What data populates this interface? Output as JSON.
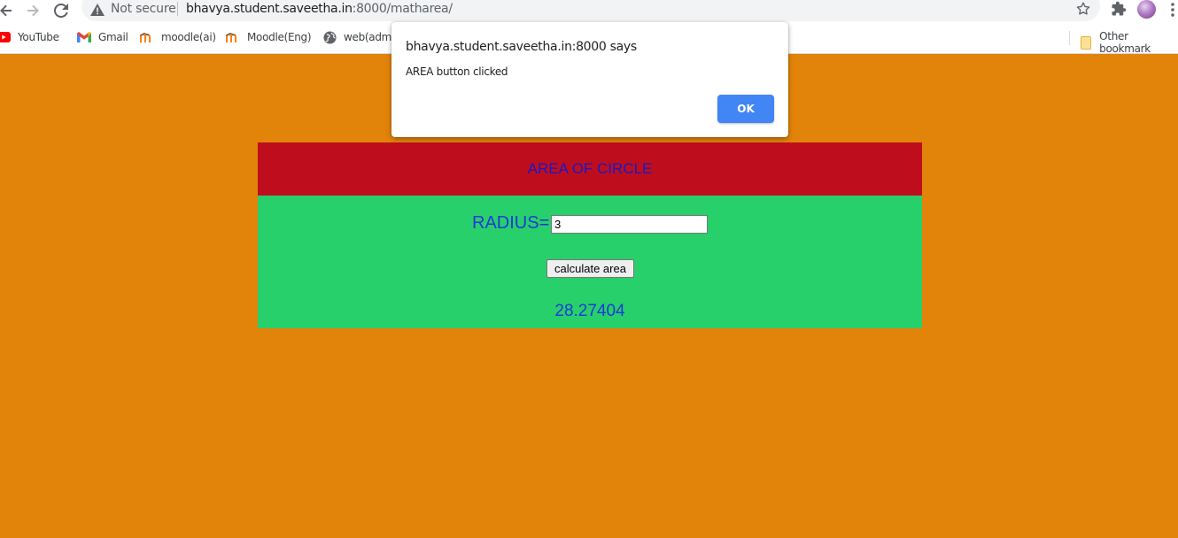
{
  "browser": {
    "security_label": "Not secure",
    "url_host": "bhavya.student.saveetha.in",
    "url_path": ":8000/matharea/",
    "bookmarks": [
      {
        "label": "YouTube",
        "icon": "youtube-icon"
      },
      {
        "label": "Gmail",
        "icon": "gmail-icon"
      },
      {
        "label": "moodle(ai)",
        "icon": "moodle-icon"
      },
      {
        "label": "Moodle(Eng)",
        "icon": "moodle-icon"
      },
      {
        "label": "web(admi",
        "icon": "globe-icon"
      }
    ],
    "other_bookmarks": "Other bookmark"
  },
  "page": {
    "title": "AREA OF CIRCLE",
    "radius_label": "RADIUS=",
    "radius_value": "3",
    "button_label": "calculate area",
    "result": "28.27404"
  },
  "dialog": {
    "title": "bhavya.student.saveetha.in:8000 says",
    "message": "AREA button clicked",
    "ok_label": "OK"
  },
  "colors": {
    "page_bg": "#e2830a",
    "header_bg": "#be0e1e",
    "form_bg": "#28d06c",
    "text_blue": "#1b3bd8",
    "ok_button": "#4285f4"
  }
}
